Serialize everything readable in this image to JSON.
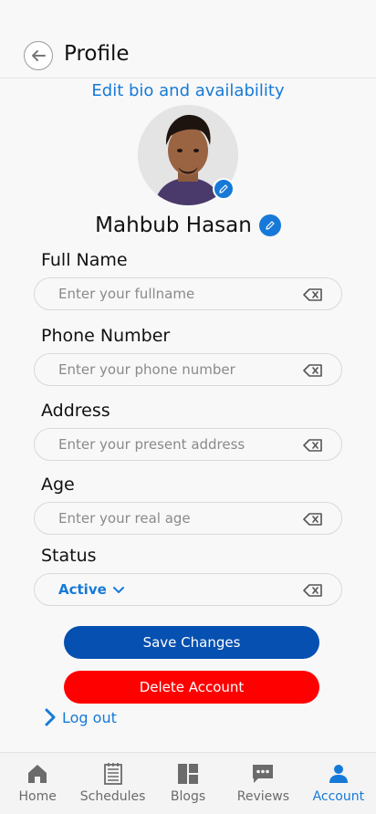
{
  "header": {
    "title": "Profile"
  },
  "profile": {
    "edit_bio_label": "Edit bio and availability",
    "name": "Mahbub Hasan"
  },
  "form": {
    "full_name": {
      "label": "Full Name",
      "placeholder": "Enter your fullname",
      "value": ""
    },
    "phone": {
      "label": "Phone Number",
      "placeholder": "Enter your phone number",
      "value": ""
    },
    "address": {
      "label": "Address",
      "placeholder": "Enter your present address",
      "value": ""
    },
    "age": {
      "label": "Age",
      "placeholder": "Enter your real age",
      "value": ""
    },
    "status": {
      "label": "Status",
      "value": "Active"
    }
  },
  "actions": {
    "save_label": "Save Changes",
    "delete_label": "Delete Account",
    "logout_label": "Log out"
  },
  "bottom_nav": {
    "items": [
      {
        "label": "Home",
        "icon": "home-icon",
        "active": false
      },
      {
        "label": "Schedules",
        "icon": "schedule-icon",
        "active": false
      },
      {
        "label": "Blogs",
        "icon": "blogs-icon",
        "active": false
      },
      {
        "label": "Reviews",
        "icon": "reviews-icon",
        "active": false
      },
      {
        "label": "Account",
        "icon": "account-icon",
        "active": true
      }
    ]
  },
  "colors": {
    "accent": "#1679d8",
    "save_button": "#0550b0",
    "delete_button": "#ff0000",
    "background": "#f8f8f8"
  }
}
